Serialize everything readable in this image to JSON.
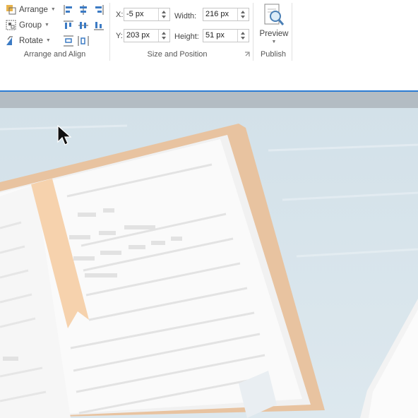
{
  "ribbon": {
    "arrange_group": {
      "arrange_label": "Arrange",
      "group_label": "Group",
      "rotate_label": "Rotate",
      "title": "Arrange and Align"
    },
    "size_group": {
      "x_label": "X:",
      "x_value": "-5 px",
      "y_label": "Y:",
      "y_value": "203 px",
      "width_label": "Width:",
      "width_value": "216 px",
      "height_label": "Height:",
      "height_value": "51 px",
      "title": "Size and Position"
    },
    "publish_group": {
      "preview_label": "Preview",
      "title": "Publish"
    }
  },
  "colors": {
    "accent_line": "#2b7cd3",
    "canvas_bg": "#d6e4ec",
    "book_cover": "#e8c3a0",
    "bookmark": "#f6d2ad"
  },
  "icons": [
    "arrange-icon",
    "group-icon",
    "rotate-icon",
    "align-left-icon",
    "align-center-icon",
    "align-right-icon",
    "align-top-icon",
    "align-middle-icon",
    "align-bottom-icon",
    "distribute-vertical-icon",
    "distribute-horizontal-icon",
    "preview-icon",
    "dialog-launcher-icon",
    "mouse-cursor-icon"
  ]
}
